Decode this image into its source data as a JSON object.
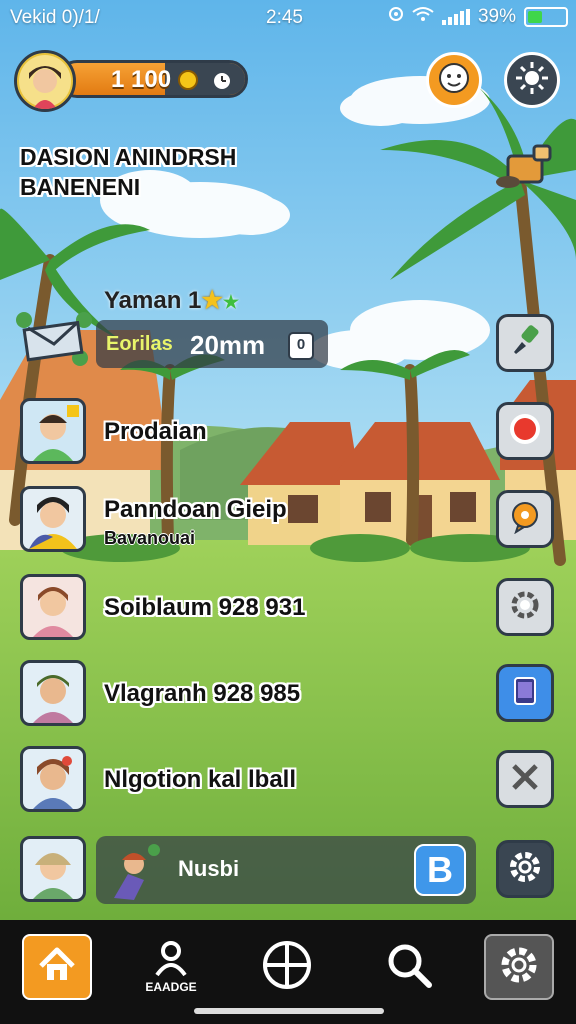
{
  "status_bar": {
    "carrier": "Vekid 0)/1/",
    "time": "2:45",
    "battery": "39%",
    "battery_level": 0.39
  },
  "profile": {
    "coins": "1 100"
  },
  "headline": {
    "line1": "DASION ANINDRSH",
    "line2": "BANENENI"
  },
  "player": {
    "level_text": "Yaman 1",
    "stat_label": "Eorilas",
    "stat_value": "20mm",
    "stat_badge": "0"
  },
  "list": [
    {
      "label": "Prodaian",
      "sub": ""
    },
    {
      "label": "Panndoan Gieip",
      "sub": "Bavanouai"
    },
    {
      "label": "Soiblaum 928 931",
      "sub": ""
    },
    {
      "label": "Vlagranh 928 985",
      "sub": ""
    },
    {
      "label": "Nlgotion kal lball",
      "sub": ""
    }
  ],
  "chat": {
    "text": "Nusbi",
    "button": "B"
  },
  "bottom_nav": {
    "caption": "EAADGE"
  },
  "icons": {
    "top_right_1": "face-icon",
    "top_right_2": "sun-icon",
    "side": [
      "shovel-icon",
      "brush-icon",
      "record-icon",
      "chat-bubble-icon",
      "gear-outline-icon",
      "tablet-icon",
      "tools-icon",
      "settings-gear-icon"
    ],
    "nav": [
      "home-icon",
      "person-icon",
      "crosshair-icon",
      "search-icon",
      "settings-icon"
    ]
  },
  "colors": {
    "accent_orange": "#f39a21",
    "dark_outline": "#2f3b48",
    "sky": "#8fd0f0",
    "grass": "#86c34a"
  }
}
